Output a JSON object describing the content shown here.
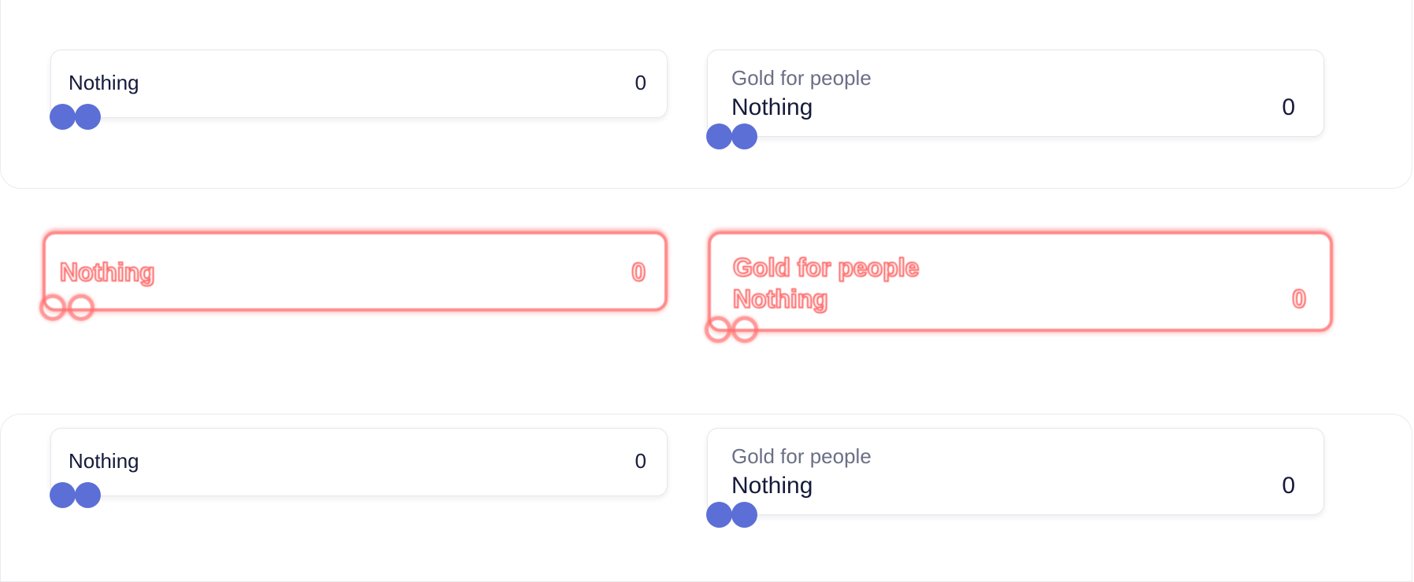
{
  "rows": {
    "top": {
      "simple": {
        "label": "Nothing",
        "value": "0"
      },
      "detailed": {
        "title": "Gold for people",
        "label": "Nothing",
        "value": "0"
      }
    },
    "ghost": {
      "simple": {
        "label": "Nothing",
        "value": "0"
      },
      "detailed": {
        "title": "Gold for people",
        "label": "Nothing",
        "value": "0"
      }
    },
    "bottom": {
      "simple": {
        "label": "Nothing",
        "value": "0"
      },
      "detailed": {
        "title": "Gold for people",
        "label": "Nothing",
        "value": "0"
      }
    }
  },
  "colors": {
    "knob": "#5b6fd6",
    "ghost_overlay": "#ff5a5a",
    "text_primary": "#141a3a",
    "text_secondary": "#6b6f86"
  }
}
